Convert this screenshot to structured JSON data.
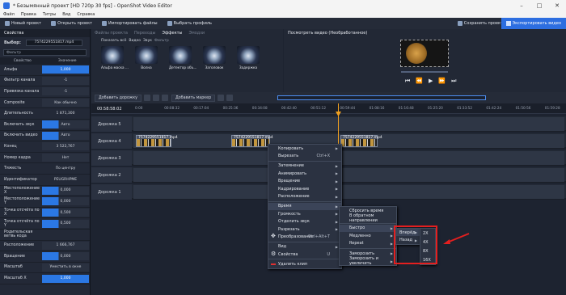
{
  "window": {
    "title": "* Безымянный проект [HD 720p 30 fps] - OpenShot Video Editor"
  },
  "menubar": [
    "Файл",
    "Правка",
    "Титры",
    "Вид",
    "Справка"
  ],
  "toolbar": {
    "new": "Новый проект",
    "open": "Открыть проект",
    "import": "Импортировать файлы",
    "profile": "Выбрать профиль",
    "save": "Сохранить проект",
    "export": "Экспортировать видео"
  },
  "properties": {
    "header": "Свойства",
    "select_label": "Выбор:",
    "select_value": "7574229551817.mp4",
    "filter_placeholder": "Фильтр",
    "col_prop": "Свойство",
    "col_val": "Значение",
    "rows": [
      {
        "k": "Альфа",
        "v": "1,000",
        "style": "blue"
      },
      {
        "k": "Фильтр канала",
        "v": "-1",
        "style": ""
      },
      {
        "k": "Привязка канала",
        "v": "-1",
        "style": ""
      },
      {
        "k": "Composite",
        "v": "Как обычно",
        "style": ""
      },
      {
        "k": "Длительность",
        "v": "1 871,300",
        "style": "none"
      },
      {
        "k": "Включить звук",
        "v": "Авто",
        "style": "half"
      },
      {
        "k": "Включить видео",
        "v": "Авто",
        "style": "half"
      },
      {
        "k": "Конец",
        "v": "3 522,767",
        "style": ""
      },
      {
        "k": "Номер кадра",
        "v": "Нет",
        "style": ""
      },
      {
        "k": "Тяжесть",
        "v": "По центру",
        "style": "none"
      },
      {
        "k": "Идентификатор",
        "v": "PEUGRHPME",
        "style": "none"
      },
      {
        "k": "Местоположение X",
        "v": "0,000",
        "style": "half"
      },
      {
        "k": "Местоположение Y",
        "v": "0,000",
        "style": "half"
      },
      {
        "k": "Точка отсчёта по X",
        "v": "0,500",
        "style": "half"
      },
      {
        "k": "Точка отсчёта по Y",
        "v": "0,500",
        "style": "half"
      },
      {
        "k": "Родительская ветвь кода",
        "v": "",
        "style": "none"
      },
      {
        "k": "Расположение",
        "v": "1 666,767",
        "style": ""
      },
      {
        "k": "Вращение",
        "v": "0,000",
        "style": "half"
      },
      {
        "k": "Масштаб",
        "v": "Уместить в окне",
        "style": ""
      },
      {
        "k": "Масштаб X",
        "v": "1,000",
        "style": "blue"
      }
    ]
  },
  "effects": {
    "tabs": [
      "Файлы проекта",
      "Переходы",
      "Эффекты",
      "Эмодзи"
    ],
    "active_tab": "Эффекты",
    "sub": [
      "Показать всё",
      "Видео",
      "Звук"
    ],
    "filter": "Фильтр",
    "items": [
      "Альфа маска ...",
      "Волна",
      "Детектор объ...",
      "Заголовок",
      "Задержка"
    ]
  },
  "preview": {
    "header": "Посмотреть видео (Необработанное)"
  },
  "timeline": {
    "add_track": "Добавить дорожку",
    "add_marker": "Добавить маркер",
    "timecode": "00:58:58:02",
    "ticks": [
      "0:00",
      "00:08:32",
      "00:17:04",
      "00:25:36",
      "00:34:08",
      "00:42:40",
      "00:51:12",
      "00:59:44",
      "01:08:16",
      "01:16:48",
      "01:25:20",
      "01:33:52",
      "01:42:24",
      "01:50:56",
      "01:59:28"
    ],
    "tracks": [
      "Дорожка 5",
      "Дорожка 4",
      "Дорожка 3",
      "Дорожка 2",
      "Дорожка 1"
    ],
    "clip_name": "7574229551817.mp4"
  },
  "context_menu": [
    {
      "label": "Копировать",
      "sc": "",
      "ar": true
    },
    {
      "label": "Вырезать",
      "sc": "Ctrl+X",
      "ar": false
    },
    {
      "sep": true
    },
    {
      "label": "Затемнение",
      "sc": "",
      "ar": true
    },
    {
      "label": "Анимировать",
      "sc": "",
      "ar": true
    },
    {
      "label": "Вращение",
      "sc": "",
      "ar": true
    },
    {
      "label": "Кадрирование",
      "sc": "",
      "ar": true
    },
    {
      "label": "Расположение",
      "sc": "",
      "ar": true
    },
    {
      "sep": true
    },
    {
      "label": "Время",
      "sc": "",
      "ar": true,
      "hl": true
    },
    {
      "label": "Громкость",
      "sc": "",
      "ar": true
    },
    {
      "label": "Отделить звук",
      "sc": "",
      "ar": true
    },
    {
      "label": "Разрезать",
      "sc": "",
      "ar": true
    },
    {
      "label": "Преобразование",
      "sc": "Ctrl+Alt+T",
      "ar": false,
      "icon": "move"
    },
    {
      "sep": true
    },
    {
      "label": "Вид",
      "sc": "",
      "ar": true
    },
    {
      "label": "Свойства",
      "sc": "U",
      "ar": false,
      "icon": "gear"
    },
    {
      "sep": true
    },
    {
      "label": "Удалить клип",
      "sc": "",
      "ar": false,
      "icon": "delete"
    }
  ],
  "time_menu": [
    {
      "label": "Сбросить время",
      "ar": false
    },
    {
      "label": "В обратном направлении",
      "ar": false
    },
    {
      "sep": true
    },
    {
      "label": "Быстро",
      "ar": true,
      "hl": true
    },
    {
      "label": "Медленно",
      "ar": true
    },
    {
      "label": "Repeat",
      "ar": true
    },
    {
      "sep": true
    },
    {
      "label": "Заморозить",
      "ar": true
    },
    {
      "label": "Заморозить и увеличить",
      "ar": true
    }
  ],
  "fast_menu": [
    {
      "label": "Вперёд",
      "ar": true,
      "hl": true
    },
    {
      "label": "Назад",
      "ar": true
    }
  ],
  "speed_menu": [
    "2X",
    "4X",
    "8X",
    "16X"
  ],
  "colors": {
    "accent": "#2d6ee0",
    "highlight": "#e41f1f",
    "playhead": "#f0a020"
  }
}
